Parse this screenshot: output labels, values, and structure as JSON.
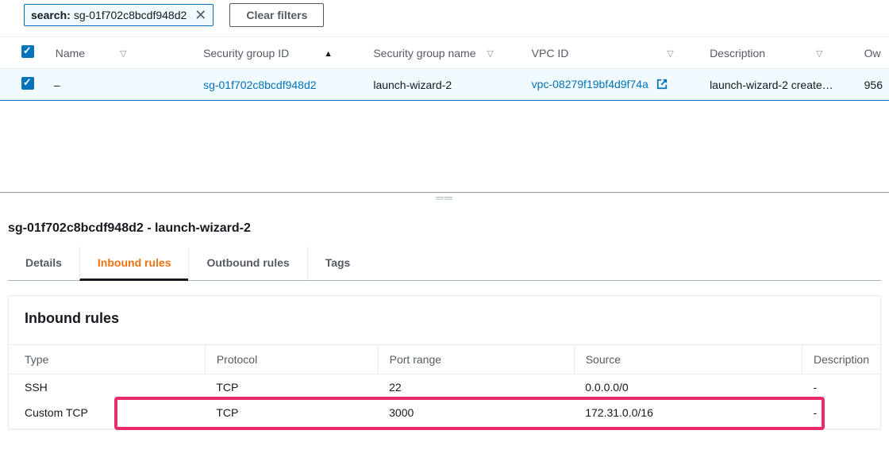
{
  "filter": {
    "label": "search:",
    "value": "sg-01f702c8bcdf948d2",
    "clear_btn": "Clear filters"
  },
  "columns": {
    "name": "Name",
    "sg_id": "Security group ID",
    "sg_name": "Security group name",
    "vpc_id": "VPC ID",
    "description": "Description",
    "owner": "Ow"
  },
  "row": {
    "name": "–",
    "sg_id": "sg-01f702c8bcdf948d2",
    "sg_name": "launch-wizard-2",
    "vpc_id": "vpc-08279f19bf4d9f74a",
    "description": "launch-wizard-2 create…",
    "owner": "956"
  },
  "detail_title": "sg-01f702c8bcdf948d2 - launch-wizard-2",
  "tabs": {
    "details": "Details",
    "inbound": "Inbound rules",
    "outbound": "Outbound rules",
    "tags": "Tags"
  },
  "panel_title": "Inbound rules",
  "rule_columns": {
    "type": "Type",
    "protocol": "Protocol",
    "port_range": "Port range",
    "source": "Source",
    "description": "Description"
  },
  "rules": [
    {
      "type": "SSH",
      "protocol": "TCP",
      "port_range": "22",
      "source": "0.0.0.0/0",
      "description": "-"
    },
    {
      "type": "Custom TCP",
      "protocol": "TCP",
      "port_range": "3000",
      "source": "172.31.0.0/16",
      "description": "-"
    }
  ]
}
